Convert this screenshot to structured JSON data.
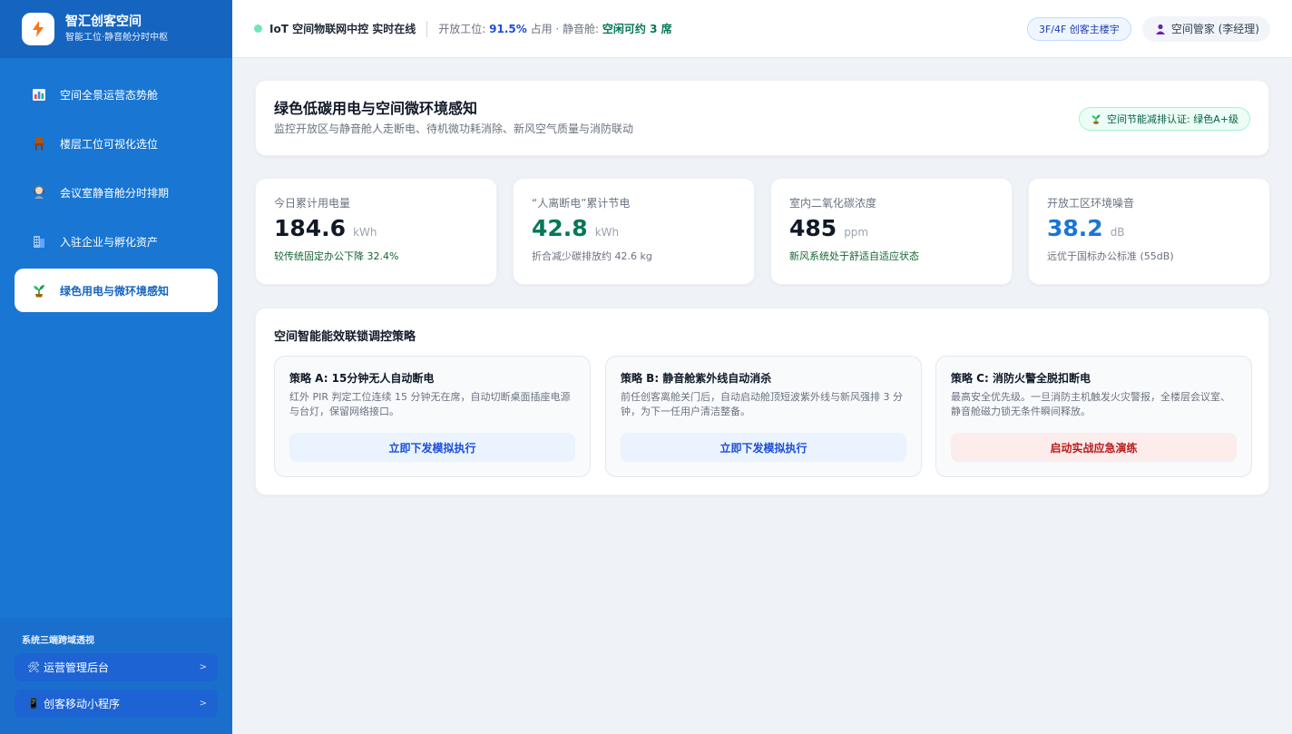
{
  "brand": {
    "title": "智汇创客空间",
    "subtitle": "智能工位·静音舱分时中枢"
  },
  "nav": {
    "items": [
      {
        "label": "空间全景运营态势舱",
        "icon": "bar-chart-icon"
      },
      {
        "label": "楼层工位可视化选位",
        "icon": "chair-icon"
      },
      {
        "label": "会议室静音舱分时排期",
        "icon": "headset-icon"
      },
      {
        "label": "入驻企业与孵化资产",
        "icon": "building-icon"
      },
      {
        "label": "绿色用电与微环境感知",
        "icon": "seedling-icon",
        "active": true
      }
    ]
  },
  "sidebar_footer": {
    "title": "系统三端跨域透视",
    "links": [
      {
        "label": "运营管理后台",
        "icon": "tools-icon",
        "arrow": ">"
      },
      {
        "label": "创客移动小程序",
        "icon": "phone-icon",
        "arrow": ">"
      }
    ]
  },
  "header": {
    "status": "IoT 空间物联网中控 实时在线",
    "info_prefix": "开放工位: ",
    "occupancy": "91.5%",
    "info_mid": " 占用 · 静音舱: ",
    "pods": "空闲可约 3 席",
    "floor_badge": "3F/4F 创客主楼宇",
    "user": "空间管家 (李经理)"
  },
  "page": {
    "title": "绿色低碳用电与空间微环境感知",
    "subtitle": "监控开放区与静音舱人走断电、待机微功耗消除、新风空气质量与消防联动",
    "cert": "空间节能减排认证: 绿色A+级"
  },
  "stats": [
    {
      "label": "今日累计用电量",
      "value": "184.6",
      "unit": "kWh",
      "note": "较传统固定办公下降 32.4%"
    },
    {
      "label": "“人离断电”累计节电",
      "value": "42.8",
      "unit": "kWh",
      "note": "折合减少碳排放约 42.6 kg"
    },
    {
      "label": "室内二氧化碳浓度",
      "value": "485",
      "unit": "ppm",
      "note": "新风系统处于舒适自适应状态"
    },
    {
      "label": "开放工区环境噪音",
      "value": "38.2",
      "unit": "dB",
      "note": "远优于国标办公标准 (55dB)"
    }
  ],
  "strategy": {
    "title": "空间智能能效联锁调控策略",
    "items": [
      {
        "title": "策略 A: 15分钟无人自动断电",
        "desc": "红外 PIR 判定工位连续 15 分钟无在席，自动切断桌面插座电源与台灯，保留网络接口。",
        "button": "立即下发模拟执行"
      },
      {
        "title": "策略 B: 静音舱紫外线自动消杀",
        "desc": "前任创客离舱关门后，自动启动舱顶短波紫外线与新风强排 3 分钟，为下一任用户清洁整备。",
        "button": "立即下发模拟执行"
      },
      {
        "title": "策略 C: 消防火警全脱扣断电",
        "desc": "最高安全优先级。一旦消防主机触发火灾警报，全楼层会议室、静音舱磁力锁无条件瞬间释放。",
        "button": "启动实战应急演练"
      }
    ]
  },
  "colors": {
    "sidebar": "#1976d2",
    "accent_blue": "#1976d2",
    "accent_green": "#047857",
    "danger": "#b91c1c"
  }
}
